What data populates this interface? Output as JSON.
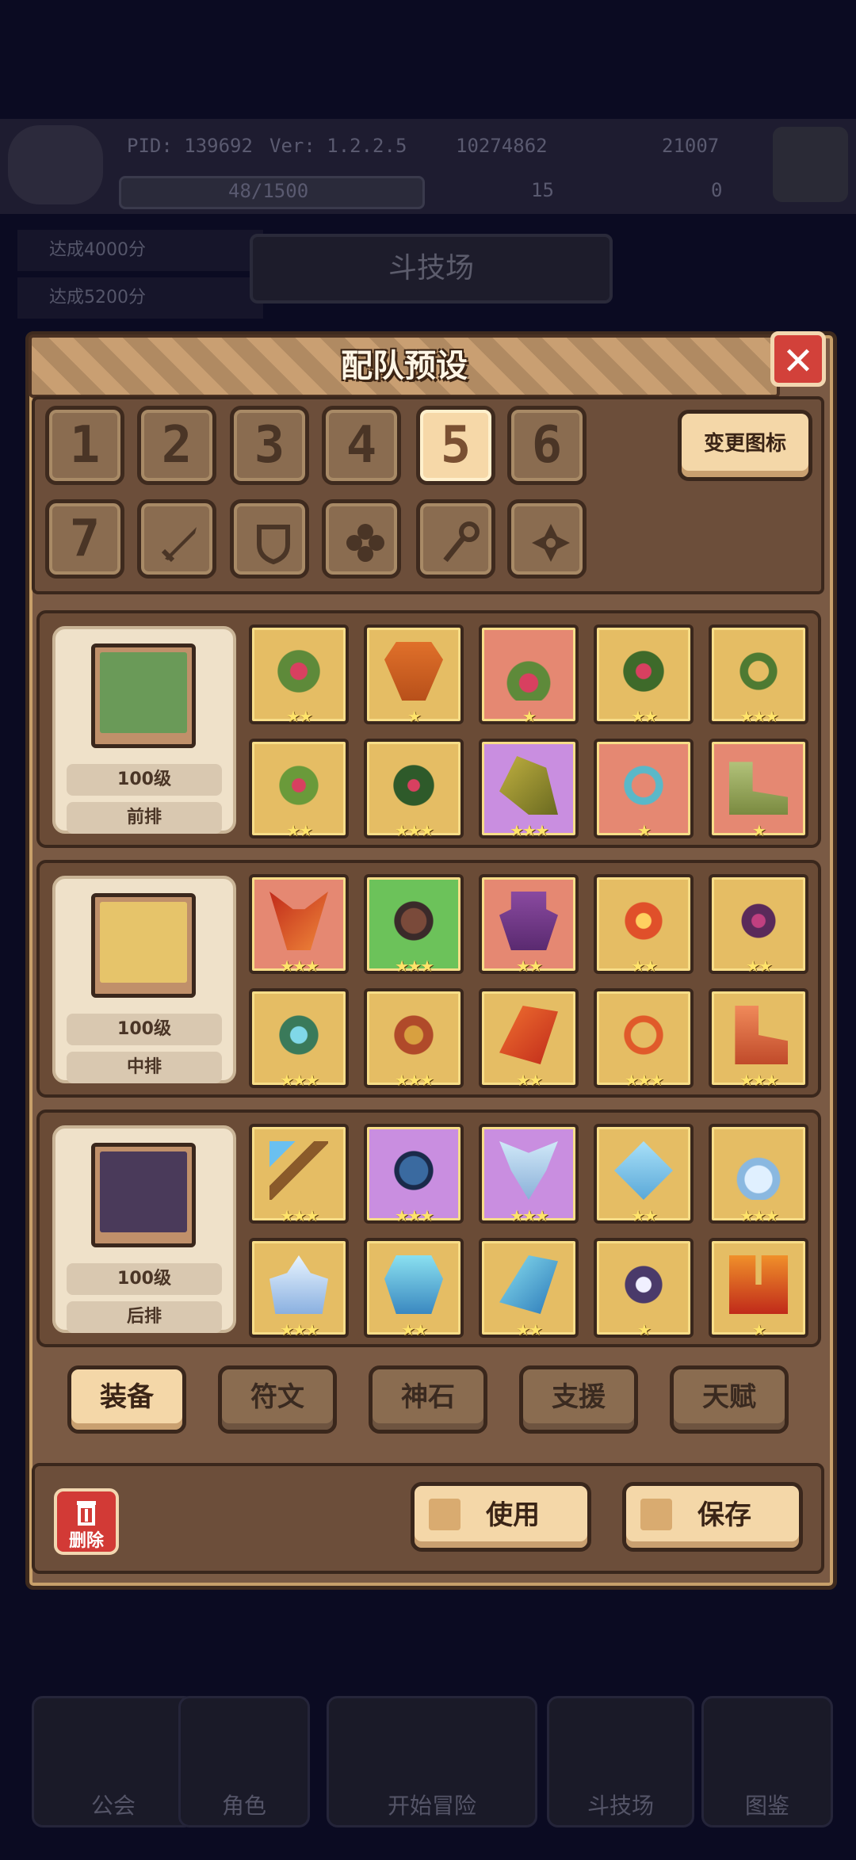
{
  "background": {
    "pid": "PID: 139692",
    "version": "Ver: 1.2.2.5",
    "gold": "10274862",
    "gems": "21007",
    "stamina": "48/1500",
    "clover": "15",
    "keys": "0",
    "screen_title": "斗技场",
    "side_items": [
      "达成4000分",
      "达成5200分"
    ],
    "nav": [
      "公会",
      "角色",
      "开始冒险",
      "斗技场",
      "图鉴"
    ]
  },
  "dialog": {
    "title": "配队预设",
    "change_icon_label": "变更图标",
    "preset_slots": [
      "1",
      "2",
      "3",
      "4",
      "5",
      "6",
      "7"
    ],
    "preset_icon_slots": [
      "sword-icon",
      "shield-icon",
      "clover-icon",
      "staff-icon",
      "flower-icon"
    ],
    "active_slot": "5",
    "teams": [
      {
        "level": "100级",
        "position": "前排",
        "portrait": "green-hero-portrait"
      },
      {
        "level": "100级",
        "position": "中排",
        "portrait": "blonde-hero-portrait"
      },
      {
        "level": "100级",
        "position": "后排",
        "portrait": "witch-hero-portrait"
      }
    ],
    "tabs": [
      "装备",
      "符文",
      "神石",
      "支援",
      "天赋"
    ],
    "active_tab": "装备",
    "delete_label": "删除",
    "use_label": "使用",
    "save_label": "保存"
  }
}
